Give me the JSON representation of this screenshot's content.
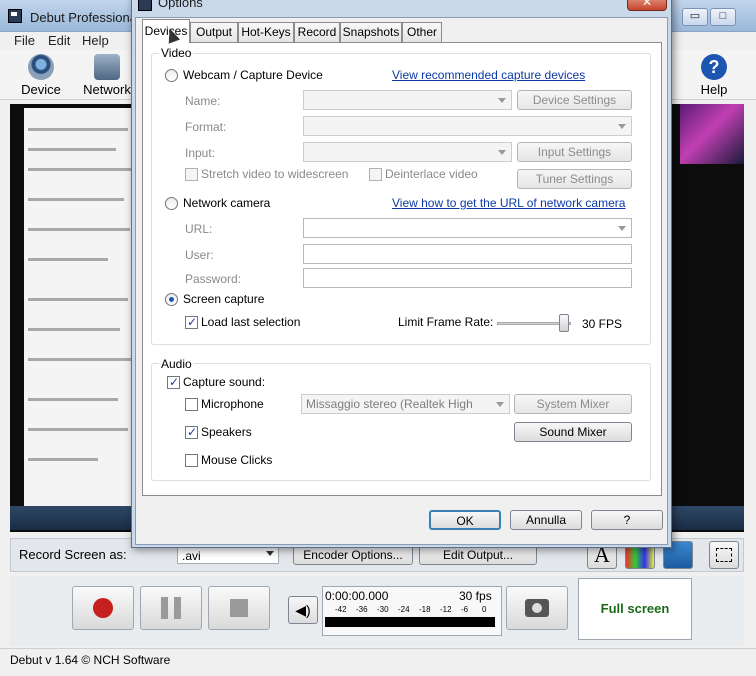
{
  "main": {
    "title": "Debut Professional",
    "menu": [
      "File",
      "Edit",
      "Help"
    ],
    "toolbar": {
      "device": "Device",
      "network": "Network",
      "help": "Help"
    },
    "record_row": {
      "label": "Record Screen as:",
      "format": ".avi",
      "encoder_options": "Encoder Options...",
      "edit_output": "Edit Output..."
    },
    "timecode": "0:00:00.000",
    "fps": "30 fps",
    "meter_ticks": [
      "-42",
      "-36",
      "-30",
      "-24",
      "-18",
      "-12",
      "-6",
      "0"
    ],
    "fullscreen": "Full screen",
    "status": "Debut v 1.64 © NCH Software"
  },
  "dialog": {
    "title": "Options",
    "tabs": [
      "Devices",
      "Output",
      "Hot-Keys",
      "Record",
      "Snapshots",
      "Other"
    ],
    "video": {
      "group_label": "Video",
      "webcam_label": "Webcam / Capture Device",
      "webcam_link": "View recommended capture devices",
      "name_label": "Name:",
      "format_label": "Format:",
      "input_label": "Input:",
      "device_settings": "Device Settings",
      "input_settings": "Input Settings",
      "tuner_settings": "Tuner Settings",
      "stretch_label": "Stretch video to widescreen",
      "deinterlace_label": "Deinterlace video",
      "network_label": "Network camera",
      "network_link": "View how to get the URL of network camera",
      "url_label": "URL:",
      "user_label": "User:",
      "password_label": "Password:",
      "screen_label": "Screen capture",
      "load_last_label": "Load last selection",
      "frame_rate_label": "Limit Frame Rate:",
      "frame_rate_value": "30 FPS",
      "frame_rate_level": 0.9
    },
    "audio": {
      "group_label": "Audio",
      "capture_label": "Capture sound:",
      "microphone_label": "Microphone",
      "speakers_label": "Speakers",
      "mouse_clicks_label": "Mouse Clicks",
      "mixer_source": "Missaggio stereo (Realtek High",
      "system_mixer": "System Mixer",
      "sound_mixer": "Sound Mixer"
    },
    "buttons": {
      "ok": "OK",
      "cancel": "Annulla",
      "help": "?"
    }
  }
}
